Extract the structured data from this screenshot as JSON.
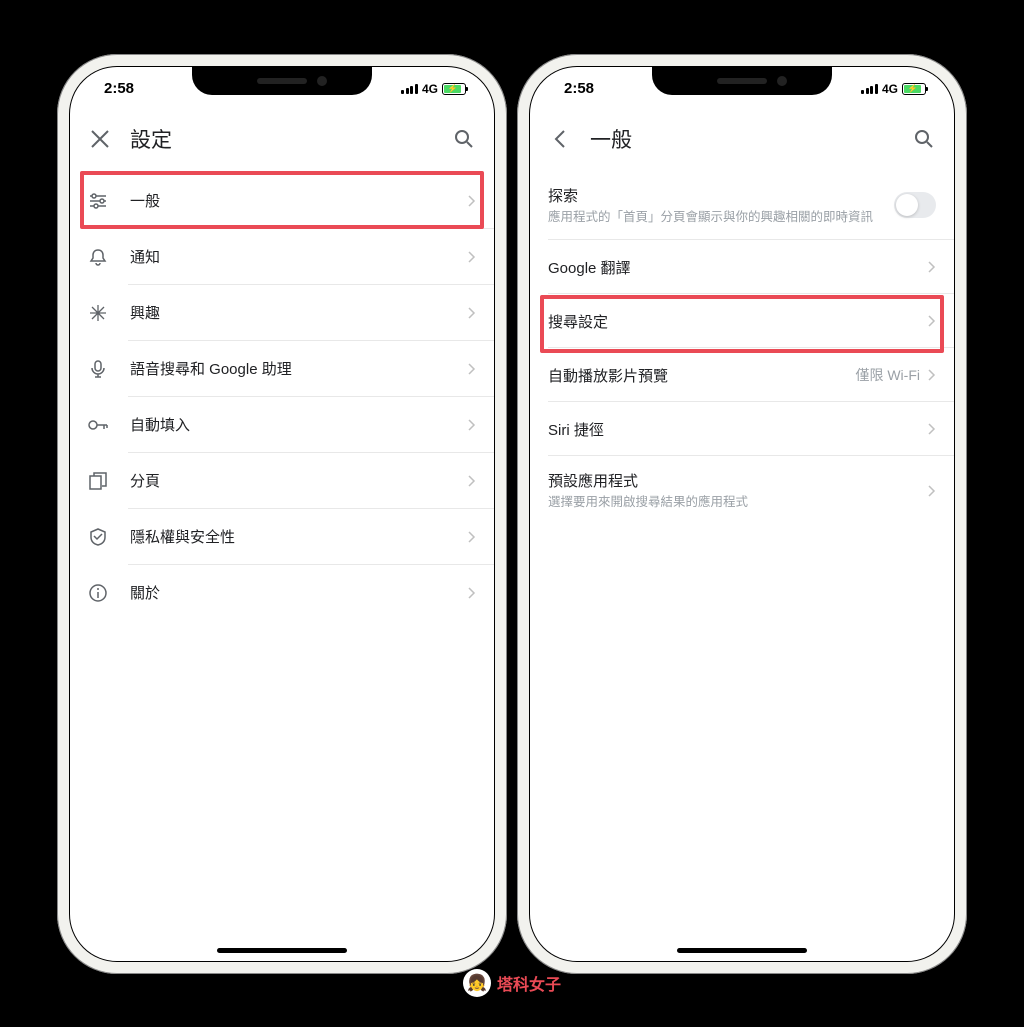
{
  "status": {
    "time": "2:58",
    "network": "4G"
  },
  "phone1": {
    "title": "設定",
    "items": [
      {
        "label": "一般",
        "icon": "sliders"
      },
      {
        "label": "通知",
        "icon": "bell"
      },
      {
        "label": "興趣",
        "icon": "star"
      },
      {
        "label": "語音搜尋和 Google 助理",
        "icon": "mic"
      },
      {
        "label": "自動填入",
        "icon": "key"
      },
      {
        "label": "分頁",
        "icon": "copy"
      },
      {
        "label": "隱私權與安全性",
        "icon": "shield"
      },
      {
        "label": "關於",
        "icon": "info"
      }
    ]
  },
  "phone2": {
    "title": "一般",
    "items": [
      {
        "label": "探索",
        "sub": "應用程式的「首頁」分頁會顯示與你的興趣相關的即時資訊",
        "type": "toggle"
      },
      {
        "label": "Google 翻譯",
        "type": "nav"
      },
      {
        "label": "搜尋設定",
        "type": "nav"
      },
      {
        "label": "自動播放影片預覽",
        "value": "僅限 Wi-Fi",
        "type": "nav"
      },
      {
        "label": "Siri 捷徑",
        "type": "nav"
      },
      {
        "label": "預設應用程式",
        "sub": "選擇要用來開啟搜尋結果的應用程式",
        "type": "nav"
      }
    ]
  },
  "watermark": "塔科女子"
}
